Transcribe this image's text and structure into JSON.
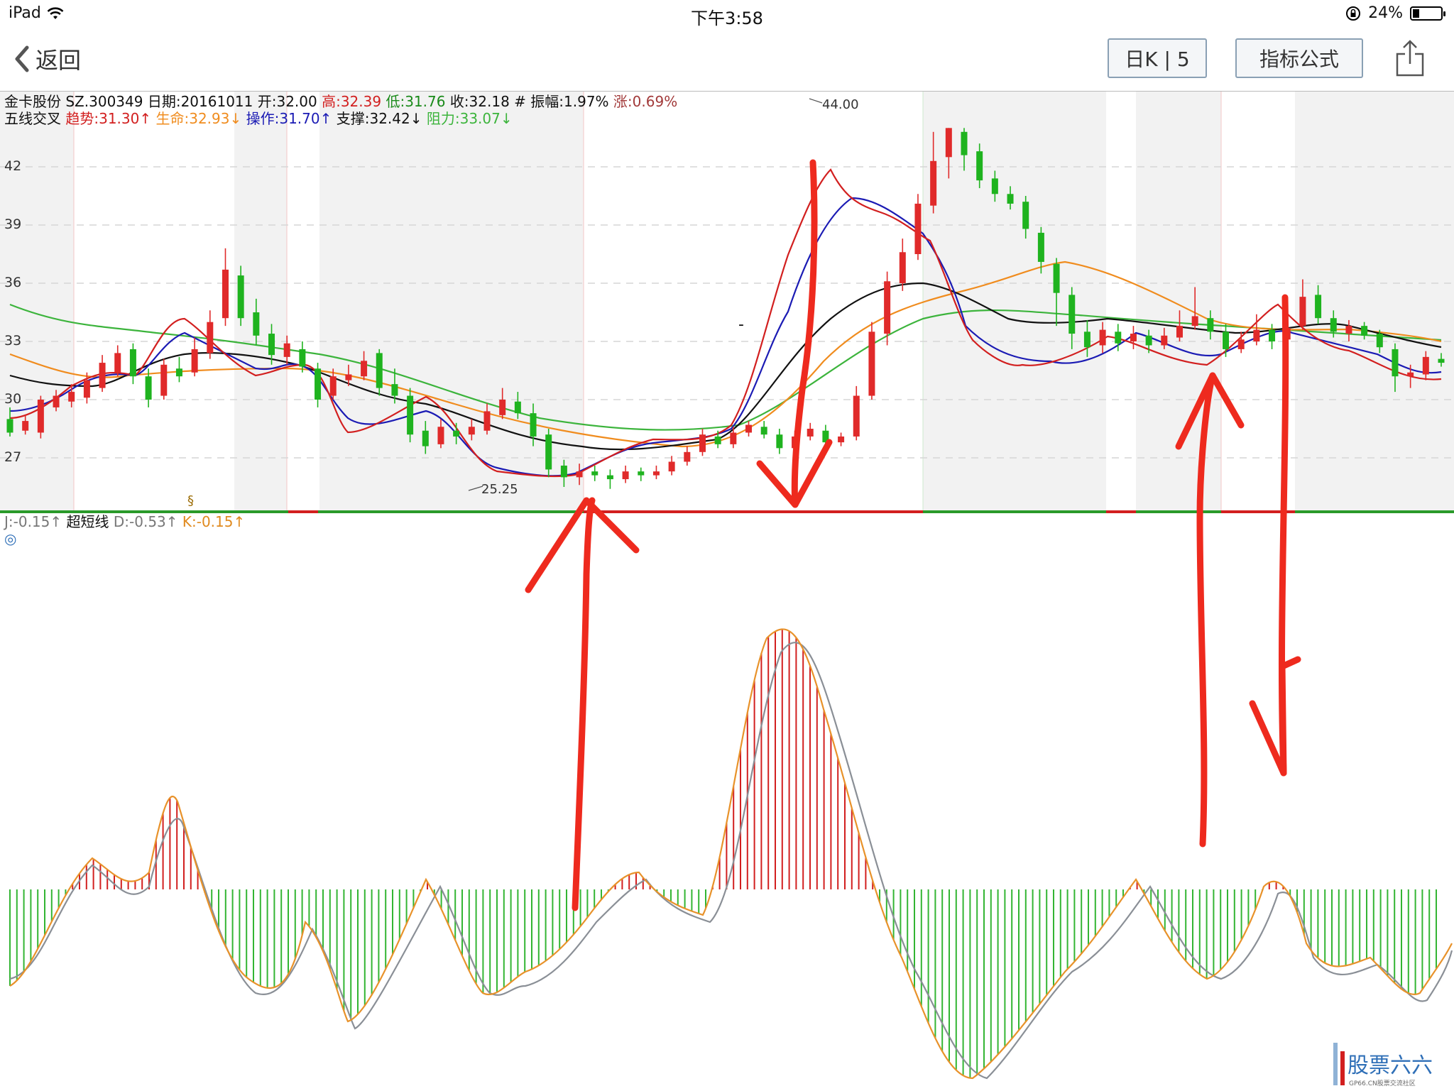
{
  "status_bar": {
    "device": "iPad",
    "time": "下午3:58",
    "battery": "24%",
    "battery_level": 0.24
  },
  "nav": {
    "back_label": "返回",
    "period_button": "日K | 5",
    "formula_button": "指标公式"
  },
  "stock_info": {
    "name": "金卡股份",
    "code": "SZ.300349",
    "date": "日期:20161011",
    "open": "开:32.00",
    "high": "高:32.39",
    "low": "低:31.76",
    "close": "收:32.18",
    "amplitude": "# 振幅:1.97%",
    "change": "涨:0.69%"
  },
  "indicator_line": {
    "name": "五线交叉",
    "trend": "趋势:31.30↑",
    "life": "生命:32.93↓",
    "operate": "操作:31.70↑",
    "support": "支撑:32.42↓",
    "resist": "阻力:33.07↓"
  },
  "kdj_line": {
    "j": "J:-0.15↑",
    "name": "超短线",
    "d": "D:-0.53↑",
    "k": "K:-0.15↑",
    "mark": "◎"
  },
  "price_axis": [
    "42",
    "39",
    "36",
    "33",
    "30",
    "27"
  ],
  "annotations": {
    "high_label": "44.00",
    "low_label": "25.25",
    "marker": "§",
    "dash": "-"
  },
  "watermark": {
    "brand": "股票六六",
    "sub": "GP66.CN股票交流社区"
  },
  "colors": {
    "up": "#e02a2a",
    "down": "#1fb31f",
    "trend": "#d21f1f",
    "life": "#f08c1e",
    "operate": "#1b1bb4",
    "support": "#111111",
    "resist": "#3cb43c",
    "annotation": "#ee2a1e"
  },
  "chart_data": {
    "type": "candlestick",
    "price_range": [
      25,
      45
    ],
    "candles_ohlc": [
      [
        29,
        28.3,
        29.6,
        28.1
      ],
      [
        28.4,
        28.9,
        29.2,
        28.2
      ],
      [
        28.3,
        30,
        30.2,
        28
      ],
      [
        29.6,
        30.2,
        30.5,
        29.4
      ],
      [
        29.9,
        30.4,
        30.8,
        29.6
      ],
      [
        30.1,
        31,
        31.4,
        29.8
      ],
      [
        30.6,
        31.9,
        32.3,
        30.4
      ],
      [
        31.4,
        32.4,
        32.8,
        31.2
      ],
      [
        32.6,
        31.2,
        32.9,
        30.8
      ],
      [
        31.2,
        30,
        31.6,
        29.6
      ],
      [
        30.2,
        31.8,
        32.1,
        30
      ],
      [
        31.6,
        31.2,
        32.2,
        30.9
      ],
      [
        31.4,
        32.6,
        33.2,
        31.2
      ],
      [
        32.4,
        34,
        34.6,
        32.1
      ],
      [
        34.2,
        36.7,
        37.8,
        33.8
      ],
      [
        36.4,
        34.2,
        36.9,
        33.8
      ],
      [
        34.5,
        33.3,
        35.2,
        32.8
      ],
      [
        33.4,
        32.3,
        33.9,
        31.8
      ],
      [
        32.2,
        32.9,
        33.3,
        31.8
      ],
      [
        32.6,
        31.7,
        33,
        31.4
      ],
      [
        31.6,
        30,
        31.9,
        29.6
      ],
      [
        30.2,
        31.2,
        31.6,
        30
      ],
      [
        31,
        31.3,
        31.8,
        30.7
      ],
      [
        31.2,
        32,
        32.5,
        31
      ],
      [
        32.4,
        30.6,
        32.6,
        30.2
      ],
      [
        30.8,
        30.2,
        31.6,
        29.8
      ],
      [
        30.2,
        28.2,
        30.6,
        27.8
      ],
      [
        28.4,
        27.6,
        28.9,
        27.2
      ],
      [
        27.7,
        28.6,
        29,
        27.5
      ],
      [
        28.4,
        28.1,
        28.8,
        27.7
      ],
      [
        28.2,
        28.6,
        29,
        27.9
      ],
      [
        28.4,
        29.4,
        29.8,
        28.2
      ],
      [
        29.2,
        30,
        30.6,
        29
      ],
      [
        29.9,
        29.3,
        30.4,
        29
      ],
      [
        29.3,
        28.1,
        29.8,
        27.6
      ],
      [
        28.2,
        26.4,
        28.5,
        26
      ],
      [
        26.6,
        26,
        26.9,
        25.5
      ],
      [
        26,
        26.3,
        26.7,
        25.6
      ],
      [
        26.3,
        26.1,
        26.6,
        25.8
      ],
      [
        26.1,
        25.9,
        26.4,
        25.4
      ],
      [
        25.9,
        26.3,
        26.6,
        25.7
      ],
      [
        26.3,
        26.1,
        26.5,
        25.8
      ],
      [
        26.1,
        26.3,
        26.6,
        25.9
      ],
      [
        26.3,
        26.8,
        27.1,
        26.1
      ],
      [
        26.8,
        27.3,
        27.6,
        26.6
      ],
      [
        27.3,
        28.2,
        28.5,
        27.1
      ],
      [
        28.1,
        27.7,
        28.4,
        27.5
      ],
      [
        27.7,
        28.3,
        28.6,
        27.5
      ],
      [
        28.3,
        28.7,
        28.9,
        28.1
      ],
      [
        28.6,
        28.2,
        28.9,
        28
      ],
      [
        28.2,
        27.5,
        28.5,
        27.2
      ],
      [
        27.5,
        28.1,
        28.4,
        27.3
      ],
      [
        28.1,
        28.5,
        28.8,
        27.9
      ],
      [
        28.4,
        27.8,
        28.7,
        27.5
      ],
      [
        27.8,
        28.1,
        28.3,
        27.6
      ],
      [
        28.1,
        30.2,
        30.7,
        27.9
      ],
      [
        30.2,
        33.5,
        34,
        30
      ],
      [
        33.4,
        36.1,
        36.6,
        32.8
      ],
      [
        36,
        37.6,
        38.3,
        35.6
      ],
      [
        37.5,
        40.1,
        40.6,
        37.2
      ],
      [
        40,
        42.3,
        43.8,
        39.6
      ],
      [
        42.5,
        44,
        44,
        41.4
      ],
      [
        43.8,
        42.6,
        44,
        41.8
      ],
      [
        42.8,
        41.3,
        43.2,
        40.9
      ],
      [
        41.4,
        40.6,
        41.8,
        40.2
      ],
      [
        40.6,
        40.1,
        41,
        39.8
      ],
      [
        40.2,
        38.8,
        40.5,
        38.3
      ],
      [
        38.6,
        37.1,
        38.9,
        36.5
      ],
      [
        37,
        35.5,
        37.3,
        33.8
      ],
      [
        35.4,
        33.4,
        35.8,
        32.6
      ],
      [
        33.5,
        32.7,
        34.1,
        32.2
      ],
      [
        32.8,
        33.6,
        34,
        32.4
      ],
      [
        33.5,
        32.9,
        33.9,
        32.5
      ],
      [
        33,
        33.4,
        33.8,
        32.6
      ],
      [
        33.3,
        32.8,
        33.6,
        32.4
      ],
      [
        32.8,
        33.3,
        33.7,
        32.6
      ],
      [
        33.2,
        33.8,
        34.6,
        33
      ],
      [
        33.8,
        34.3,
        35.8,
        33.6
      ],
      [
        34.2,
        33.5,
        34.6,
        33.1
      ],
      [
        33.5,
        32.6,
        33.9,
        32.2
      ],
      [
        32.6,
        33.1,
        33.5,
        32.4
      ],
      [
        33,
        33.6,
        34.4,
        32.8
      ],
      [
        33.6,
        33,
        33.9,
        32.6
      ],
      [
        33.1,
        33.7,
        34,
        32.9
      ],
      [
        33.8,
        35.3,
        36.2,
        33.6
      ],
      [
        35.4,
        34.2,
        35.9,
        33.9
      ],
      [
        34.2,
        33.5,
        34.6,
        33.2
      ],
      [
        33.4,
        33.8,
        34.1,
        33
      ],
      [
        33.8,
        33.3,
        34,
        33.1
      ],
      [
        33.4,
        32.7,
        33.6,
        32.4
      ],
      [
        32.6,
        31.2,
        32.9,
        30.4
      ],
      [
        31.2,
        31.4,
        31.8,
        30.6
      ],
      [
        31.3,
        32.2,
        32.5,
        31
      ],
      [
        32.1,
        31.9,
        32.4,
        31.7
      ]
    ],
    "indicator_series": [
      "趋势",
      "生命",
      "操作",
      "支撑",
      "阻力"
    ],
    "kdj_histogram_range": [
      -0.6,
      1
    ]
  }
}
